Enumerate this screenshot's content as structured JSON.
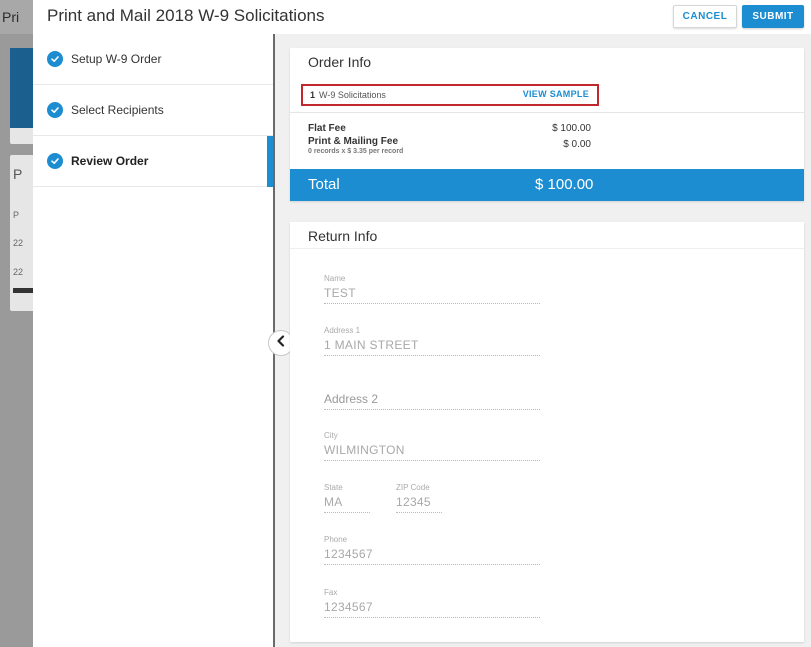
{
  "background": {
    "title": "Pri",
    "letter": "P",
    "small_1": "P",
    "small_2": "22",
    "small_3": "22"
  },
  "modal": {
    "title": "Print and Mail 2018 W-9 Solicitations",
    "cancel_label": "CANCEL",
    "submit_label": "SUBMIT"
  },
  "steps": [
    {
      "label": "Setup W-9 Order"
    },
    {
      "label": "Select Recipients"
    },
    {
      "label": "Review Order"
    }
  ],
  "order_info": {
    "title": "Order Info",
    "item_qty": "1",
    "item_name": "W-9 Solicitations",
    "view_sample": "VIEW SAMPLE",
    "flat_fee_label": "Flat Fee",
    "flat_fee_amount": "$ 100.00",
    "print_fee_label": "Print & Mailing Fee",
    "print_fee_sub": "0 records x $ 3.35 per record",
    "print_fee_amount": "$ 0.00",
    "total_label": "Total",
    "total_amount": "$ 100.00"
  },
  "return_info": {
    "title": "Return Info",
    "name_label": "Name",
    "name_value": "TEST",
    "address1_label": "Address 1",
    "address1_value": "1 MAIN STREET",
    "address2_placeholder": "Address 2",
    "city_label": "City",
    "city_value": "WILMINGTON",
    "state_label": "State",
    "state_value": "MA",
    "zip_label": "ZIP Code",
    "zip_value": "12345",
    "phone_label": "Phone",
    "phone_value": "1234567",
    "fax_label": "Fax",
    "fax_value": "1234567"
  },
  "colors": {
    "accent": "#1b8dd0",
    "highlight_border": "#c0282e"
  }
}
